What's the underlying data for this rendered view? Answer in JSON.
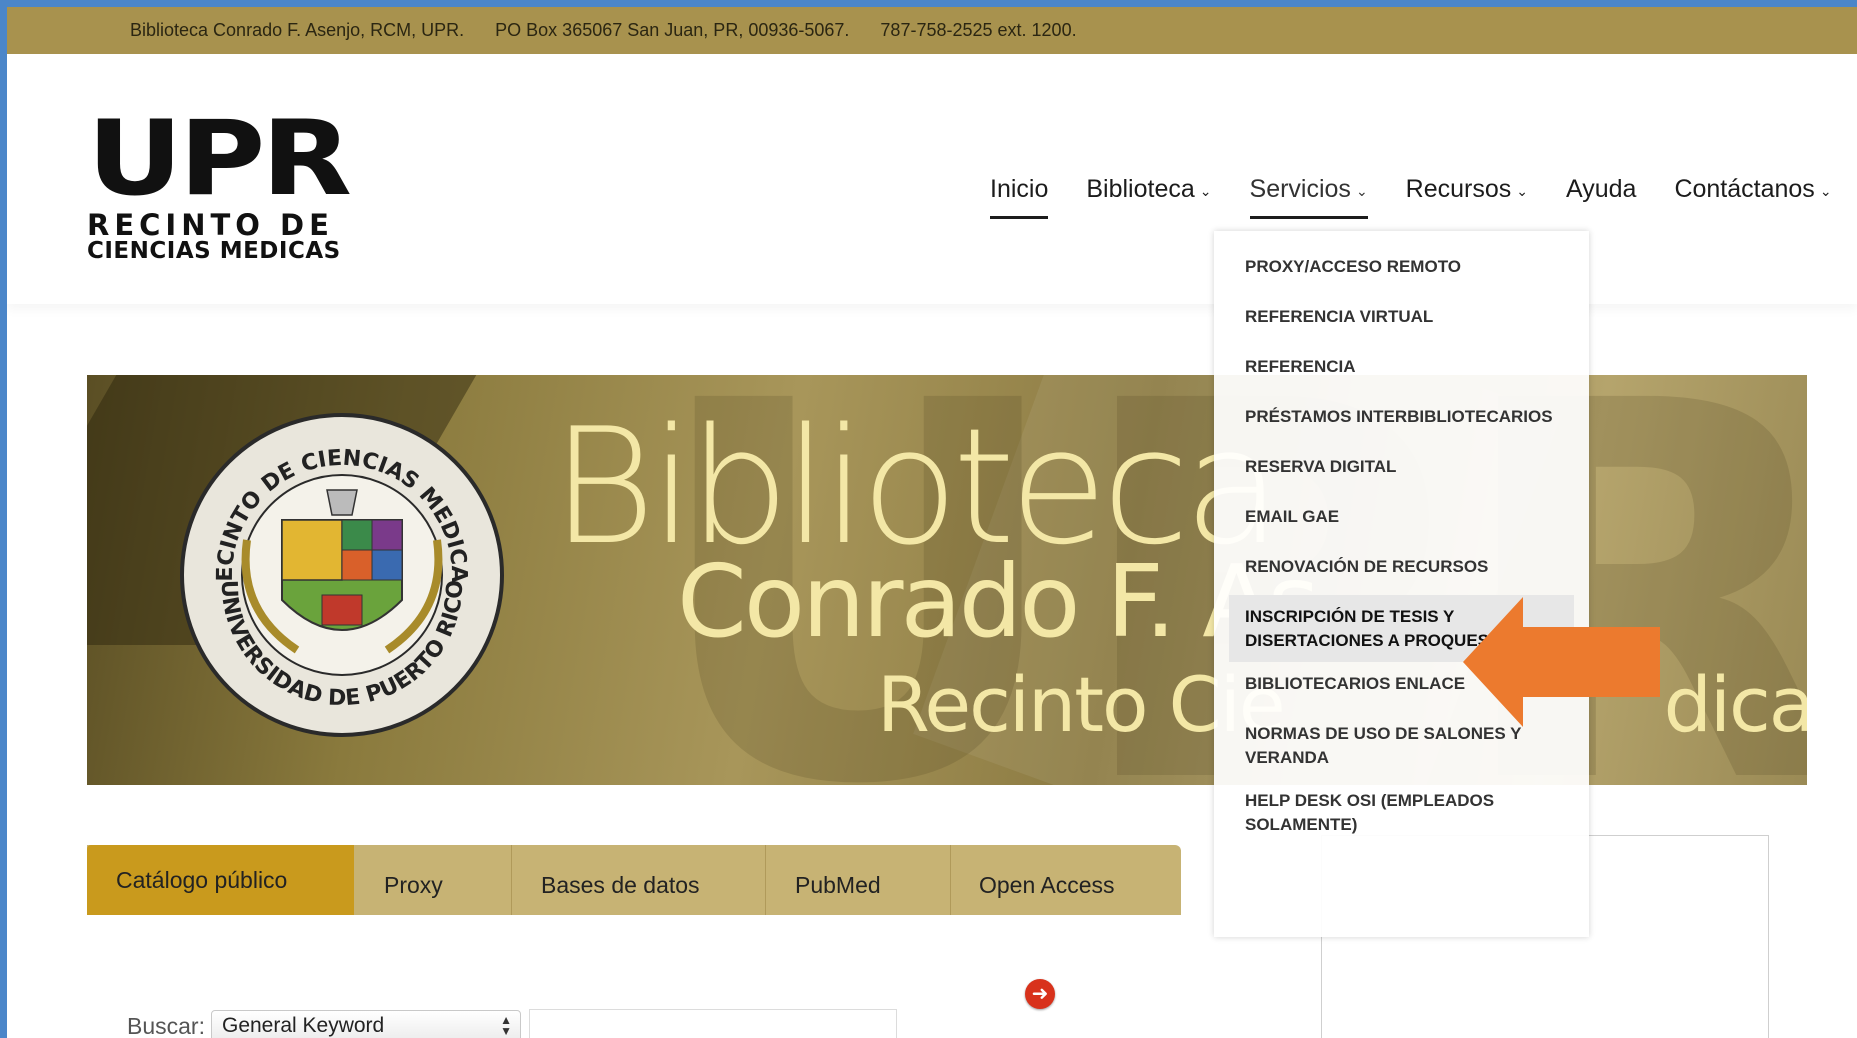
{
  "topbar": {
    "name": "Biblioteca Conrado F. Asenjo, RCM, UPR.",
    "address": "PO Box 365067 San Juan, PR, 00936-5067.",
    "phone": "787-758-2525 ext. 1200."
  },
  "logo": {
    "main": "UPR",
    "line1": "RECINTO DE",
    "line2": "CIENCIAS MEDICAS"
  },
  "nav": {
    "items": [
      {
        "label": "Inicio"
      },
      {
        "label": "Biblioteca"
      },
      {
        "label": "Servicios"
      },
      {
        "label": "Recursos"
      },
      {
        "label": "Ayuda"
      },
      {
        "label": "Contáctanos"
      }
    ]
  },
  "dropdown": {
    "items": [
      "PROXY/ACCESO REMOTO",
      "REFERENCIA VIRTUAL",
      "REFERENCIA",
      "PRÉSTAMOS INTERBIBLIOTECARIOS",
      "RESERVA DIGITAL",
      "EMAIL GAE",
      "RENOVACIÓN DE RECURSOS",
      "INSCRIPCIÓN DE TESIS Y DISERTACIONES A PROQUEST/UMI",
      "BIBLIOTECARIOS ENLACE",
      "NORMAS DE USO DE SALONES Y VERANDA",
      "HELP DESK OSI (EMPLEADOS SOLAMENTE)"
    ],
    "highlighted_index": 7,
    "arrow_color": "#ec7a2e"
  },
  "banner": {
    "title": "Biblioteca",
    "subtitle": "Conrado F. As",
    "subtitle2": "Recinto Cie",
    "subtitle2_tail": "dicas",
    "ghost_text": "UPR",
    "seal_top": "RECINTO DE CIENCIAS MEDICAS",
    "seal_bottom": "UNIVERSIDAD DE PUERTO RICO"
  },
  "tabs": [
    {
      "label": "Catálogo público",
      "active": true
    },
    {
      "label": "Proxy",
      "active": false
    },
    {
      "label": "Bases de datos",
      "active": false
    },
    {
      "label": "PubMed",
      "active": false
    },
    {
      "label": "Open Access",
      "active": false
    }
  ],
  "search": {
    "label": "Buscar:",
    "select_value": "General Keyword",
    "input_value": ""
  },
  "colors": {
    "topbar": "#a8924e",
    "tab_active": "#c99a1d",
    "tabs_bg": "#c7b374",
    "go_button": "#d8321c"
  }
}
